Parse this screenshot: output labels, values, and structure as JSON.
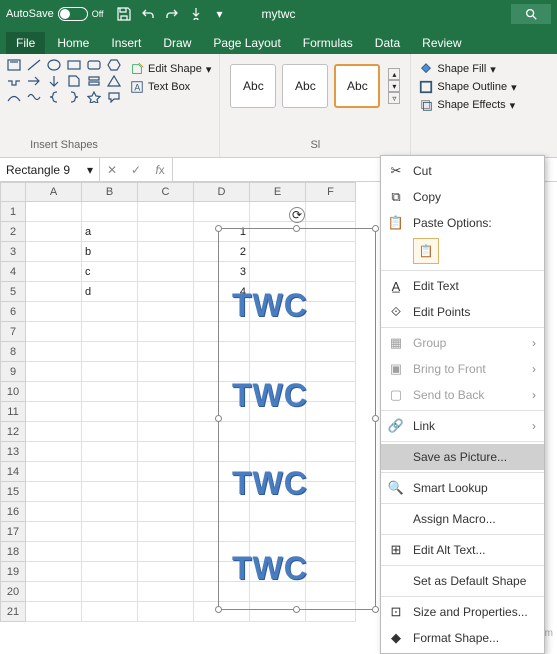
{
  "titlebar": {
    "autosave_label": "AutoSave",
    "autosave_state": "Off",
    "doc_title": "mytwc"
  },
  "ribbon_tabs": {
    "file": "File",
    "home": "Home",
    "insert": "Insert",
    "draw": "Draw",
    "page_layout": "Page Layout",
    "formulas": "Formulas",
    "data": "Data",
    "review": "Review"
  },
  "ribbon": {
    "insert_shapes_label": "Insert Shapes",
    "edit_shape": "Edit Shape",
    "text_box": "Text Box",
    "abc": "Abc",
    "shape_styles_short": "Sl",
    "shape_fill": "Shape Fill",
    "shape_outline": "Shape Outline",
    "shape_effects": "Shape Effects"
  },
  "namebox": {
    "value": "Rectangle 9"
  },
  "columns": [
    "A",
    "B",
    "C",
    "D",
    "E",
    "F"
  ],
  "row_headers": [
    "1",
    "2",
    "3",
    "4",
    "5",
    "6",
    "7",
    "8",
    "9",
    "10",
    "11",
    "12",
    "13",
    "14",
    "15",
    "16",
    "17",
    "18",
    "19",
    "20",
    "21"
  ],
  "cells": {
    "B2": "a",
    "B3": "b",
    "B4": "c",
    "B5": "d",
    "D2": "1",
    "D3": "2",
    "D4": "3",
    "D5": "4"
  },
  "wordart_text": "TWC",
  "context_menu": {
    "cut": "Cut",
    "copy": "Copy",
    "paste_options": "Paste Options:",
    "edit_text": "Edit Text",
    "edit_points": "Edit Points",
    "group": "Group",
    "bring_front": "Bring to Front",
    "send_back": "Send to Back",
    "link": "Link",
    "save_as_picture": "Save as Picture...",
    "smart_lookup": "Smart Lookup",
    "assign_macro": "Assign Macro...",
    "edit_alt_text": "Edit Alt Text...",
    "set_default": "Set as Default Shape",
    "size_props": "Size and Properties...",
    "format_shape": "Format Shape..."
  },
  "watermark": "wsxdn.com"
}
